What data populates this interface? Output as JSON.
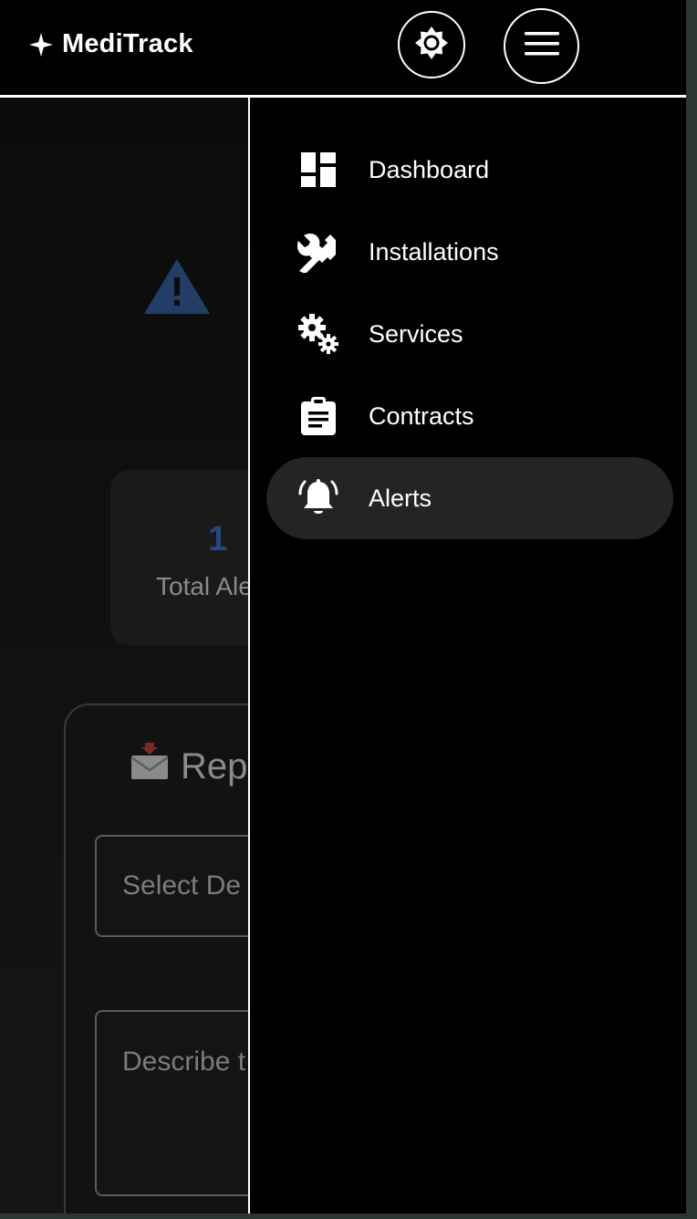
{
  "header": {
    "brand_glyph": "✦",
    "brand_name": "MediTrack",
    "theme_toggle_icon": "brightness-icon",
    "menu_icon": "hamburger-icon"
  },
  "menu": {
    "items": [
      {
        "label": "Dashboard",
        "icon": "dashboard-icon",
        "active": false
      },
      {
        "label": "Installations",
        "icon": "wrench-icon",
        "active": false
      },
      {
        "label": "Services",
        "icon": "gears-icon",
        "active": false
      },
      {
        "label": "Contracts",
        "icon": "clipboard-icon",
        "active": false
      },
      {
        "label": "Alerts",
        "icon": "bell-ringing-icon",
        "active": true
      }
    ]
  },
  "background_page": {
    "warning_icon": "warning-triangle-icon",
    "stat": {
      "value": "1",
      "label": "Total Ale"
    },
    "report": {
      "icon": "incoming-envelope-icon",
      "title": "Repo",
      "select_placeholder": "Select De",
      "textarea_placeholder": "Describe t"
    }
  },
  "colors": {
    "background": "#000000",
    "menu_active": "#242424",
    "accent_blue": "#234a7c",
    "frame": "#2c3630"
  }
}
